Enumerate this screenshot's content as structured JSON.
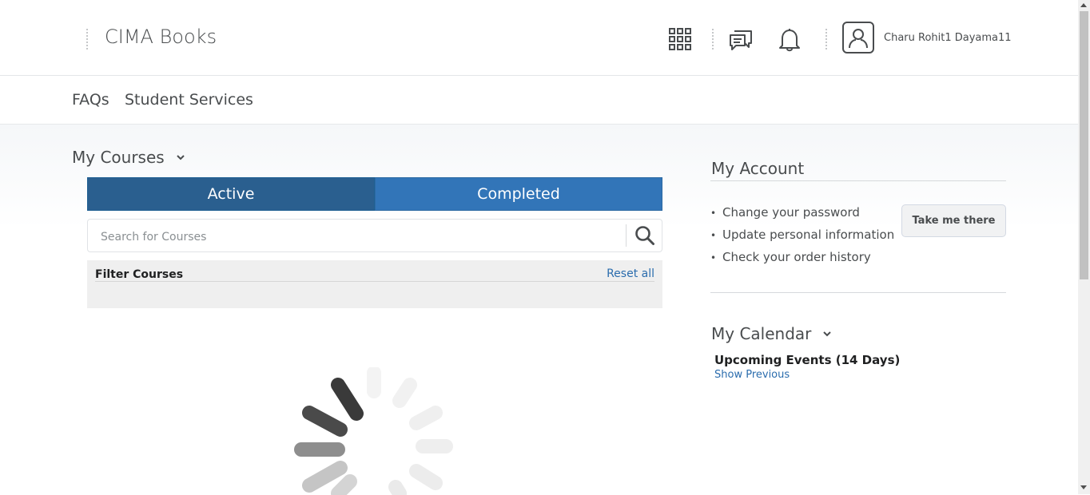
{
  "header": {
    "brand": "CIMA Books",
    "username": "Charu Rohit1 Dayama11",
    "icons": [
      "grid-icon",
      "chat-icon",
      "bell-icon",
      "user-icon"
    ]
  },
  "nav": {
    "items": [
      "FAQs",
      "Student Services"
    ]
  },
  "courses": {
    "title": "My Courses",
    "tabs": [
      "Active",
      "Completed"
    ],
    "selected_tab": "Active",
    "search_placeholder": "Search for Courses",
    "filter_label": "Filter Courses",
    "reset_label": "Reset all"
  },
  "account": {
    "title": "My Account",
    "items": [
      "Change your password",
      "Update personal information",
      "Check your order history"
    ],
    "button_label": "Take me there"
  },
  "calendar": {
    "title": "My Calendar",
    "events_title": "Upcoming Events (14 Days)",
    "show_previous": "Show Previous"
  },
  "colors": {
    "active_tab": "#2a5f8f",
    "inactive_tab": "#3275b8",
    "link": "#2a6cad",
    "text": "#494c4e"
  }
}
